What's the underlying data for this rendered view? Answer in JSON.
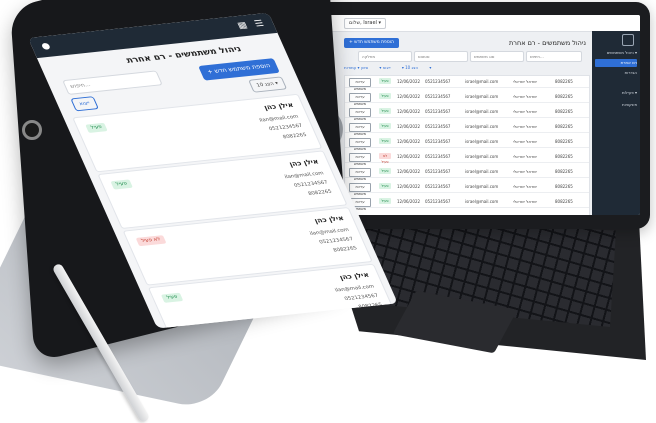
{
  "laptop": {
    "topbar": {
      "user_button": "שלום, Israel ▾"
    },
    "sidebar": {
      "items": [
        {
          "label": "ניהול משתמשים ▾"
        },
        {
          "label": "רם אחרת"
        },
        {
          "label": "הגדרות"
        },
        {
          "label": "פעילות ▾"
        },
        {
          "label": "פונקציות"
        }
      ]
    },
    "page": {
      "title": "ניהול משתמשים - רם אחרת",
      "add_button": "+ הוספת משתמש חדש",
      "filters": [
        "חיפוש...",
        "סוג משתמש",
        "סטטוס",
        "מחלקה"
      ],
      "tabs": [
        "הצג 10 ▾",
        "ייצוא ▾",
        "סינון ▾",
        "עמודות ▾"
      ]
    },
    "rows": [
      {
        "id": "8082265",
        "name": "ישראל ישראלי",
        "email": "israel@mail.com",
        "phone": "0521234567",
        "date": "12/06/2022",
        "status": "ok",
        "status_label": "פעיל",
        "action": "עריכת משתמש"
      },
      {
        "id": "8082265",
        "name": "ישראל ישראלי",
        "email": "israel@mail.com",
        "phone": "0521234567",
        "date": "12/06/2022",
        "status": "ok",
        "status_label": "פעיל",
        "action": "עריכת משתמש"
      },
      {
        "id": "8082265",
        "name": "ישראל ישראלי",
        "email": "israel@mail.com",
        "phone": "0521234567",
        "date": "12/06/2022",
        "status": "ok",
        "status_label": "פעיל",
        "action": "עריכת משתמש"
      },
      {
        "id": "8082265",
        "name": "ישראל ישראלי",
        "email": "israel@mail.com",
        "phone": "0521234567",
        "date": "12/06/2022",
        "status": "ok",
        "status_label": "פעיל",
        "action": "עריכת משתמש"
      },
      {
        "id": "8082265",
        "name": "ישראל ישראלי",
        "email": "israel@mail.com",
        "phone": "0521234567",
        "date": "12/06/2022",
        "status": "ok",
        "status_label": "פעיל",
        "action": "עריכת משתמש"
      },
      {
        "id": "8082265",
        "name": "ישראל ישראלי",
        "email": "israel@mail.com",
        "phone": "0521234567",
        "date": "12/06/2022",
        "status": "bad",
        "status_label": "לא פעיל",
        "action": "עריכת משתמש"
      },
      {
        "id": "8082265",
        "name": "ישראל ישראלי",
        "email": "israel@mail.com",
        "phone": "0521234567",
        "date": "12/06/2022",
        "status": "ok",
        "status_label": "פעיל",
        "action": "עריכת משתמש"
      },
      {
        "id": "8082265",
        "name": "ישראל ישראלי",
        "email": "israel@mail.com",
        "phone": "0521234567",
        "date": "12/06/2022",
        "status": "ok",
        "status_label": "פעיל",
        "action": "עריכת משתמש"
      },
      {
        "id": "8082265",
        "name": "ישראל ישראלי",
        "email": "israel@mail.com",
        "phone": "0521234567",
        "date": "12/06/2022",
        "status": "ok",
        "status_label": "פעיל",
        "action": "עריכת משתמש"
      }
    ]
  },
  "tablet": {
    "page": {
      "title": "ניהול משתמשים - רם אחרת",
      "add_button": "+ הוספת משתמש חדש",
      "search_placeholder": "חיפוש...",
      "export_button": "ייצוא",
      "show_button": "הצג 10 ▾"
    },
    "cards": [
      {
        "name": "אילן כהן",
        "email": "ilan@mail.com",
        "phone": "0521234567",
        "id": "8082265",
        "status": "ok",
        "status_label": "פעיל"
      },
      {
        "name": "אילן כהן",
        "email": "ilan@mail.com",
        "phone": "0521234567",
        "id": "8082265",
        "status": "ok",
        "status_label": "פעיל"
      },
      {
        "name": "אילן כהן",
        "email": "ilan@mail.com",
        "phone": "0521234567",
        "id": "8082265",
        "status": "bad",
        "status_label": "לא פעיל"
      },
      {
        "name": "אילן כהן",
        "email": "ilan@mail.com",
        "phone": "0521234567",
        "id": "8082265",
        "status": "ok",
        "status_label": "פעיל"
      }
    ]
  },
  "colors": {
    "accent": "#2f6fd6",
    "sidebar_dark": "#1f2a36",
    "status_ok": "#1c8a4a",
    "status_bad": "#c0392b"
  },
  "icons": [
    "menu-icon",
    "grid-icon",
    "user-icon",
    "mail-icon",
    "phone-icon"
  ]
}
